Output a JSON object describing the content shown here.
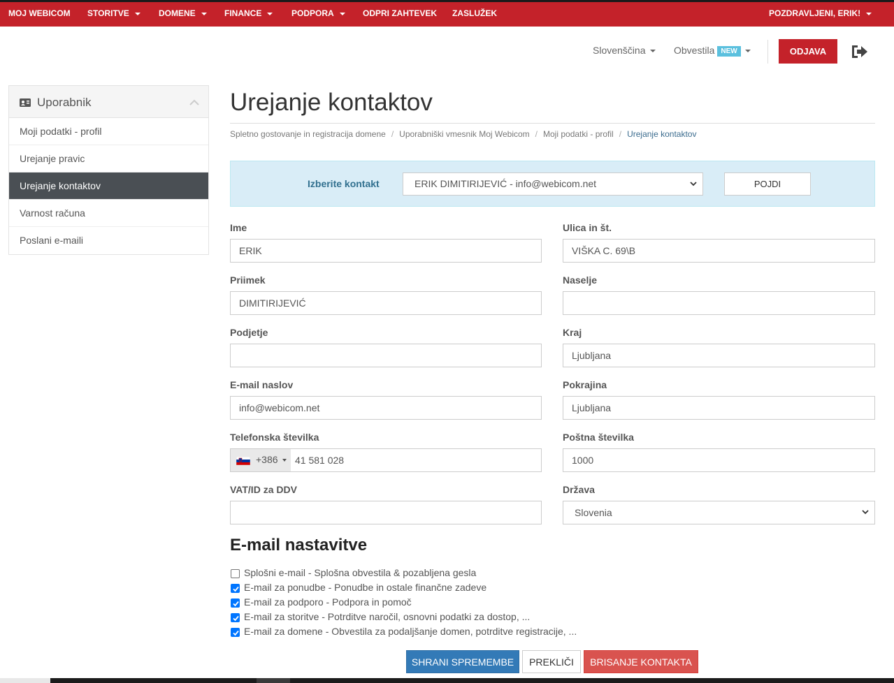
{
  "topnav": {
    "items": [
      {
        "label": "MOJ WEBICOM",
        "dropdown": false
      },
      {
        "label": "STORITVE",
        "dropdown": true
      },
      {
        "label": "DOMENE",
        "dropdown": true
      },
      {
        "label": "FINANCE",
        "dropdown": true
      },
      {
        "label": "PODPORA",
        "dropdown": true
      },
      {
        "label": "ODPRI ZAHTEVEK",
        "dropdown": false
      },
      {
        "label": "ZASLUŽEK",
        "dropdown": false
      }
    ],
    "greeting": "POZDRAVLJENI, ERIK!",
    "color": "#c4222a"
  },
  "header": {
    "language": "Slovenščina",
    "notifications": "Obvestila",
    "notifications_badge": "NEW",
    "logout_label": "ODJAVA"
  },
  "sidebar": {
    "title": "Uporabnik",
    "items": [
      {
        "label": "Moji podatki - profil",
        "active": false
      },
      {
        "label": "Urejanje pravic",
        "active": false
      },
      {
        "label": "Urejanje kontaktov",
        "active": true
      },
      {
        "label": "Varnost računa",
        "active": false
      },
      {
        "label": "Poslani e-maili",
        "active": false
      }
    ]
  },
  "main": {
    "title": "Urejanje kontaktov",
    "breadcrumb": [
      "Spletno gostovanje in registracija domene",
      "Uporabniški vmesnik Moj Webicom",
      "Moji podatki - profil",
      "Urejanje kontaktov"
    ],
    "contact_selector": {
      "label": "Izberite kontakt",
      "selected": "ERIK DIMITIRIJEVIĆ - info@webicom.net",
      "button": "POJDI"
    },
    "form": {
      "ime": {
        "label": "Ime",
        "value": "ERIK"
      },
      "priimek": {
        "label": "Priimek",
        "value": "DIMITIRIJEVIĆ"
      },
      "podjetje": {
        "label": "Podjetje",
        "value": ""
      },
      "email": {
        "label": "E-mail naslov",
        "value": "info@webicom.net"
      },
      "telefon": {
        "label": "Telefonska številka",
        "dial_code": "+386",
        "value": "41 581 028"
      },
      "vat": {
        "label": "VAT/ID za DDV",
        "value": ""
      },
      "ulica": {
        "label": "Ulica in št.",
        "value": "VIŠKA C. 69\\B"
      },
      "naselje": {
        "label": "Naselje",
        "value": ""
      },
      "kraj": {
        "label": "Kraj",
        "value": "Ljubljana"
      },
      "pokrajina": {
        "label": "Pokrajina",
        "value": "Ljubljana"
      },
      "postna": {
        "label": "Poštna številka",
        "value": "1000"
      },
      "drzava": {
        "label": "Država",
        "value": "Slovenia"
      }
    },
    "email_settings": {
      "title": "E-mail nastavitve",
      "options": [
        {
          "label": "Splošni e-mail - Splošna obvestila & pozabljena gesla",
          "checked": false
        },
        {
          "label": "E-mail za ponudbe - Ponudbe in ostale finančne zadeve",
          "checked": true
        },
        {
          "label": "E-mail za podporo - Podpora in pomoč",
          "checked": true
        },
        {
          "label": "E-mail za storitve - Potrditve naročil, osnovni podatki za dostop, ...",
          "checked": true
        },
        {
          "label": "E-mail za domene - Obvestila za podaljšanje domen, potrditve registracije, ...",
          "checked": true
        }
      ]
    },
    "buttons": {
      "save": "SHRANI SPREMEMBE",
      "cancel": "PREKLIČI",
      "delete": "BRISANJE KONTAKTA"
    }
  }
}
